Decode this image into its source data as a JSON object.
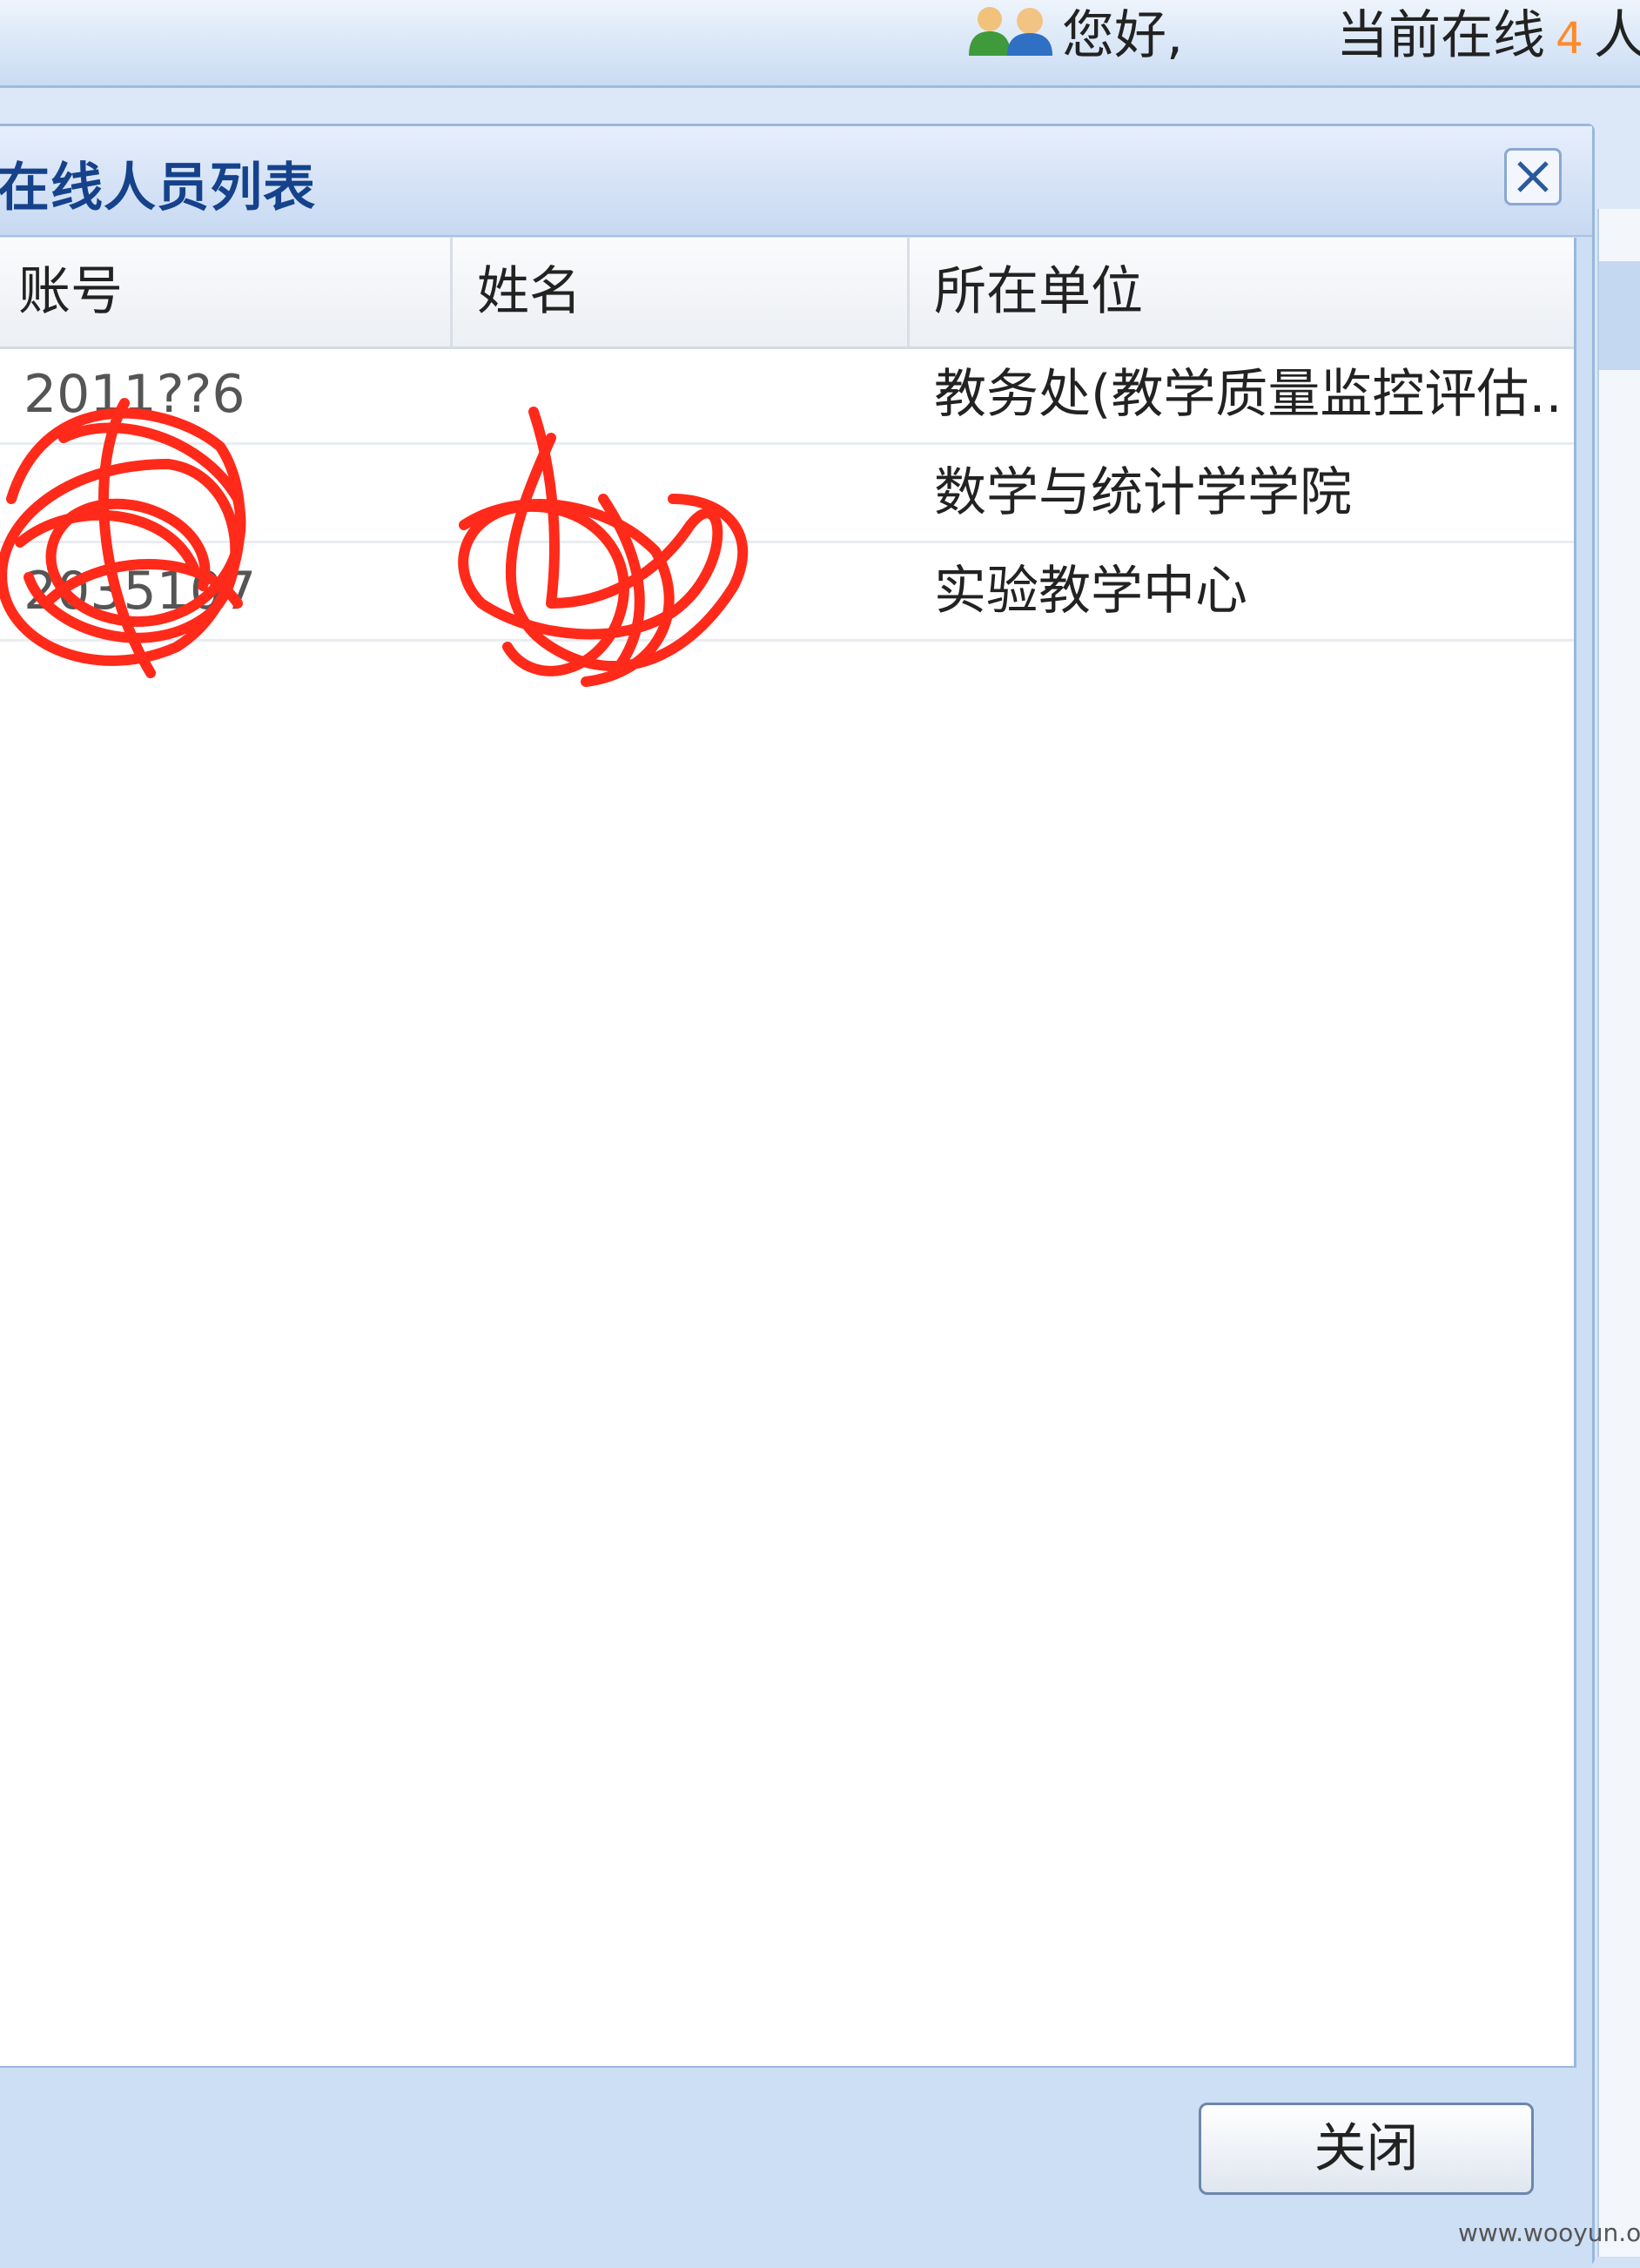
{
  "topbar": {
    "greeting": "您好,",
    "online_prefix": "当前在线",
    "online_count": "4",
    "online_suffix": "人"
  },
  "dialog": {
    "title": "在线人员列表",
    "close_icon": "close-x-icon",
    "columns": [
      "账号",
      "姓名",
      "所在单位"
    ],
    "rows": [
      {
        "account": "2011??6",
        "name": "",
        "unit": "教务处(教学质量监控评估..."
      },
      {
        "account": "",
        "name": "",
        "unit": "数学与统计学学院"
      },
      {
        "account": "2035107",
        "name": "",
        "unit": "实验教学中心"
      }
    ],
    "close_button": "关闭"
  },
  "watermark": "www.wooyun.org",
  "colors": {
    "title": "#15428b",
    "count": "#ff8a2a",
    "scribble": "#ff2a1a",
    "dialog_bg": "#cddff4"
  }
}
